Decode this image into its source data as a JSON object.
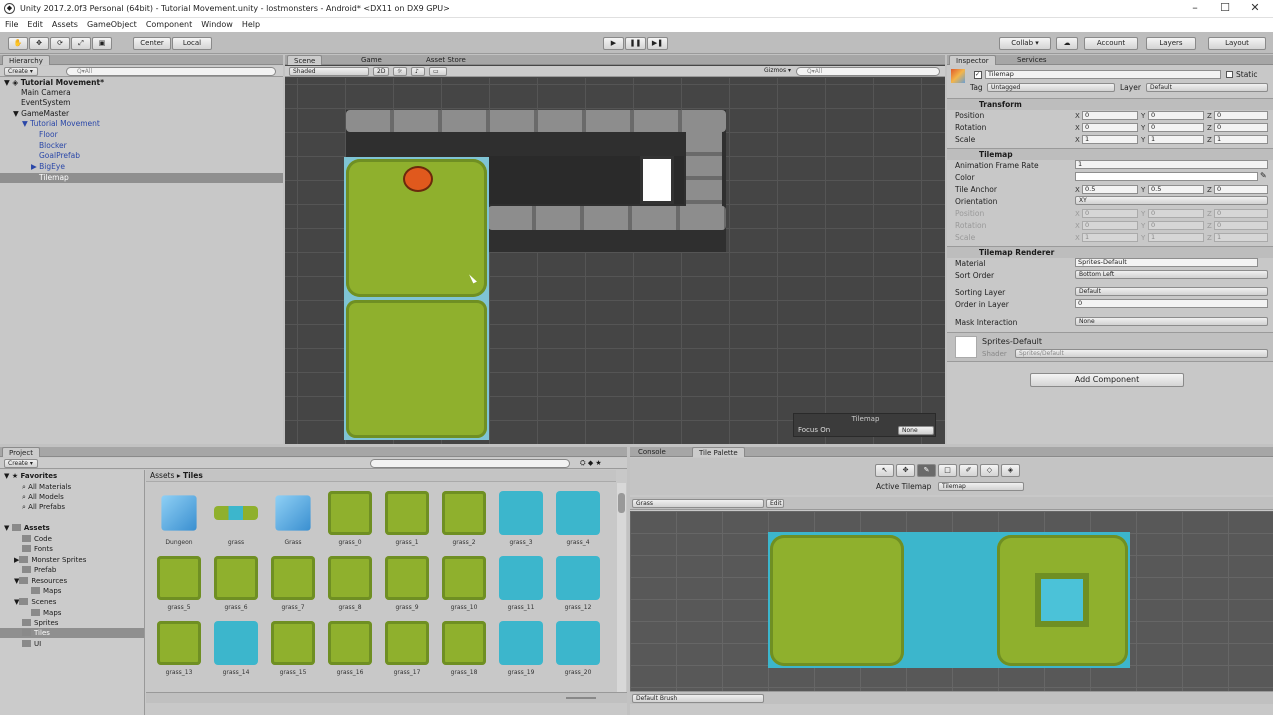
{
  "window": {
    "title": "Unity 2017.2.0f3 Personal (64bit) - Tutorial Movement.unity - lostmonsters - Android* <DX11 on DX9 GPU>"
  },
  "menu": [
    "File",
    "Edit",
    "Assets",
    "GameObject",
    "Component",
    "Window",
    "Help"
  ],
  "toolbar": {
    "center": "Center",
    "local": "Local",
    "collab": "Collab ▾",
    "account": "Account",
    "layers": "Layers",
    "layout": "Layout"
  },
  "hierarchy": {
    "tab": "Hierarchy",
    "create": "Create ▾",
    "search_placeholder": "Q▾All",
    "scene": "Tutorial Movement*",
    "items": [
      "Main Camera",
      "EventSystem",
      "GameMaster",
      "Tutorial Movement",
      "Floor",
      "Blocker",
      "GoalPrefab",
      "BigEye",
      "Tilemap"
    ]
  },
  "scene": {
    "tabs": [
      "Scene",
      "Game",
      "Asset Store"
    ],
    "shading": "Shaded",
    "mode2d": "2D",
    "gizmos": "Gizmos ▾",
    "search_placeholder": "Q▾All",
    "overlay_title": "Tilemap",
    "focus_label": "Focus On",
    "focus_value": "None"
  },
  "inspector": {
    "tabs": [
      "Inspector",
      "Services"
    ],
    "object_name": "Tilemap",
    "static_label": "Static",
    "tag_label": "Tag",
    "tag_value": "Untagged",
    "layer_label": "Layer",
    "layer_value": "Default",
    "transform": {
      "title": "Transform",
      "position_label": "Position",
      "position": [
        "0",
        "0",
        "0"
      ],
      "rotation_label": "Rotation",
      "rotation": [
        "0",
        "0",
        "0"
      ],
      "scale_label": "Scale",
      "scale": [
        "1",
        "1",
        "1"
      ]
    },
    "tilemap": {
      "title": "Tilemap",
      "anim_rate_label": "Animation Frame Rate",
      "anim_rate": "1",
      "color_label": "Color",
      "anchor_label": "Tile Anchor",
      "anchor": [
        "0.5",
        "0.5",
        "0"
      ],
      "orientation_label": "Orientation",
      "orientation": "XY",
      "position_label": "Position",
      "position": [
        "0",
        "0",
        "0"
      ],
      "rotation_label": "Rotation",
      "rotation": [
        "0",
        "0",
        "0"
      ],
      "scale_label": "Scale",
      "scale": [
        "1",
        "1",
        "1"
      ]
    },
    "renderer": {
      "title": "Tilemap Renderer",
      "material_label": "Material",
      "material": "Sprites-Default",
      "sort_order_label": "Sort Order",
      "sort_order": "Bottom Left",
      "sorting_layer_label": "Sorting Layer",
      "sorting_layer": "Default",
      "order_label": "Order in Layer",
      "order": "0",
      "mask_label": "Mask Interaction",
      "mask": "None"
    },
    "material_block": {
      "name": "Sprites-Default",
      "shader_label": "Shader",
      "shader": "Sprites/Default"
    },
    "add_component": "Add Component"
  },
  "project": {
    "tab": "Project",
    "create": "Create ▾",
    "breadcrumb_root": "Assets",
    "breadcrumb_sep": "▸",
    "breadcrumb_leaf": "Tiles",
    "favorites": {
      "title": "Favorites",
      "items": [
        "All Materials",
        "All Models",
        "All Prefabs"
      ]
    },
    "assets_title": "Assets",
    "folders": [
      "Code",
      "Fonts",
      "Monster Sprites",
      "Prefab",
      "Resources",
      "Maps",
      "Scenes",
      "Maps",
      "Sprites",
      "Tiles",
      "UI"
    ],
    "assets": [
      {
        "name": "Dungeon",
        "kind": "cube"
      },
      {
        "name": "grass",
        "kind": "brush"
      },
      {
        "name": "Grass",
        "kind": "cube"
      },
      {
        "name": "grass_0",
        "kind": "grass"
      },
      {
        "name": "grass_1",
        "kind": "grass"
      },
      {
        "name": "grass_2",
        "kind": "grass"
      },
      {
        "name": "grass_3",
        "kind": "water"
      },
      {
        "name": "grass_4",
        "kind": "water"
      },
      {
        "name": "grass_5",
        "kind": "grass"
      },
      {
        "name": "grass_6",
        "kind": "grass"
      },
      {
        "name": "grass_7",
        "kind": "grass"
      },
      {
        "name": "grass_8",
        "kind": "grass"
      },
      {
        "name": "grass_9",
        "kind": "grass"
      },
      {
        "name": "grass_10",
        "kind": "grass"
      },
      {
        "name": "grass_11",
        "kind": "water"
      },
      {
        "name": "grass_12",
        "kind": "water"
      },
      {
        "name": "grass_13",
        "kind": "grass"
      },
      {
        "name": "grass_14",
        "kind": "water"
      },
      {
        "name": "grass_15",
        "kind": "grass"
      },
      {
        "name": "grass_16",
        "kind": "grass"
      },
      {
        "name": "grass_17",
        "kind": "grass"
      },
      {
        "name": "grass_18",
        "kind": "grass"
      },
      {
        "name": "grass_19",
        "kind": "water"
      },
      {
        "name": "grass_20",
        "kind": "water"
      }
    ]
  },
  "palette": {
    "tabs": [
      "Console",
      "Tile Palette"
    ],
    "active_tilemap_label": "Active Tilemap",
    "active_tilemap": "Tilemap",
    "palette_name": "Grass",
    "edit": "Edit",
    "brush": "Default Brush"
  }
}
